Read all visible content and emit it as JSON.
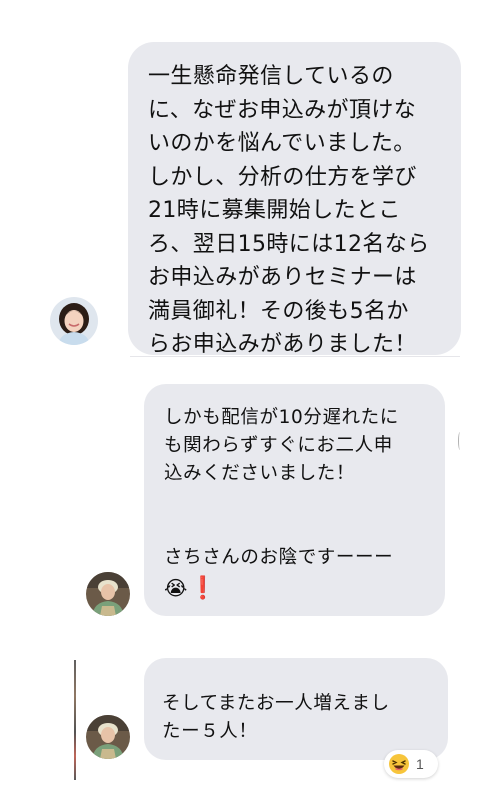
{
  "messages": [
    {
      "id": "msg1",
      "text": "一生懸命発信しているの\nに、なぜお申込みが頂けな\nいのかを悩んでいました。\nしかし、分析の仕方を学び\n21時に募集開始したとこ\nろ、翌日15時には12名なら\nお申込みがありセミナーは\n満員御礼！その後も5名か\nらお申込みがありました！"
    },
    {
      "id": "msg2",
      "text": "しかも配信が10分遅れたに\nも関わらずすぐにお二人申\n込みくださいました！\n\n\nさちさんのお陰ですーーー",
      "emoji": "😭",
      "exclamation": "❗"
    },
    {
      "id": "msg3",
      "text": "そしてまたお一人増えまし\nたー５人！"
    }
  ],
  "reaction": {
    "emoji": "😆",
    "count": "1"
  },
  "colors": {
    "bubble": "#e8e9ee",
    "text": "#111111",
    "exclamation": "#e0302a"
  },
  "icons": {
    "avatar1": "woman-avatar",
    "avatar2": "woman-avatar",
    "avatar3": "woman-avatar"
  }
}
